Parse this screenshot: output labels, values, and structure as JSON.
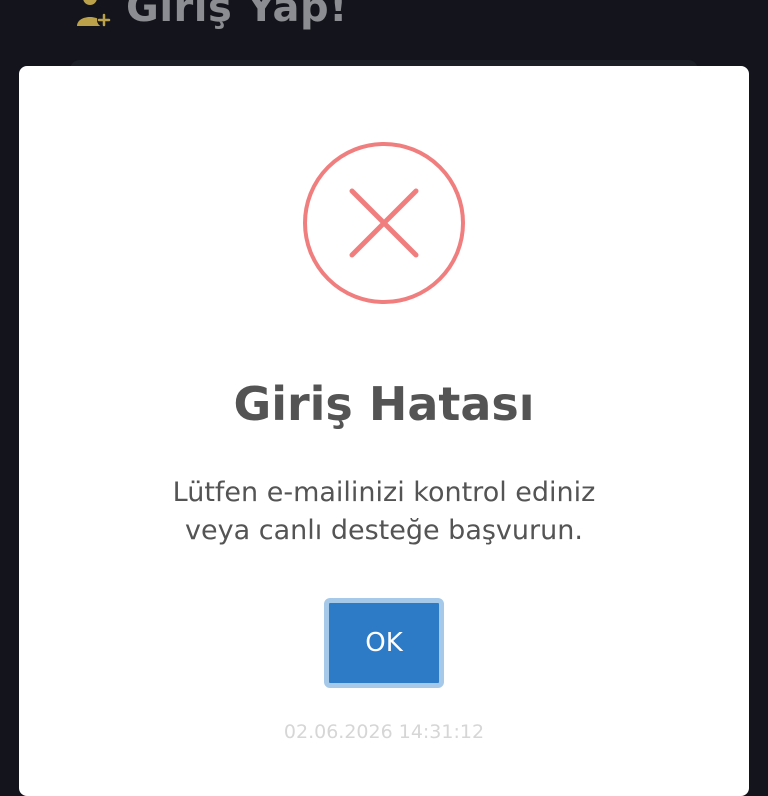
{
  "header": {
    "title": "Giriş Yap!",
    "icon": "user-add-icon",
    "icon_color": "#bba14a"
  },
  "dialog": {
    "icon": "error-x-icon",
    "icon_color": "#f07e7e",
    "title": "Giriş Hatası",
    "message_line_1": "Lütfen e-mailinizi kontrol ediniz",
    "message_line_2": "veya canlı desteğe başvurun.",
    "ok_label": "OK",
    "ok_color": "#2d7ac7",
    "timestamp": "02.06.2026 14:31:12"
  }
}
